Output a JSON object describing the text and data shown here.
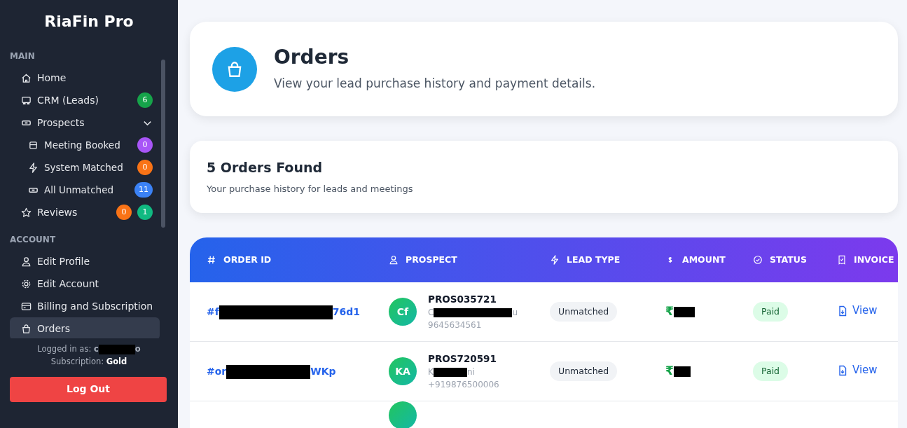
{
  "brand": "RiaFin Pro",
  "nav_sections": [
    {
      "title": "MAIN",
      "items": [
        {
          "label": "Home",
          "selected": false
        },
        {
          "label": "CRM (Leads)",
          "selected": false,
          "badges": [
            {
              "text": "6",
              "color": "#16a34a"
            }
          ]
        },
        {
          "label": "Prospects",
          "selected": false,
          "expanded": true,
          "children": [
            {
              "label": "Meeting Booked",
              "selected": false,
              "badges": [
                {
                  "text": "0",
                  "color": "#a855f7"
                }
              ]
            },
            {
              "label": "System Matched",
              "selected": false,
              "badges": [
                {
                  "text": "0",
                  "color": "#f97316"
                }
              ]
            },
            {
              "label": "All Unmatched",
              "selected": false,
              "badges": [
                {
                  "text": "11",
                  "color": "#3b82f6"
                }
              ]
            }
          ]
        },
        {
          "label": "Reviews",
          "selected": false,
          "badges": [
            {
              "text": "0",
              "color": "#f97316"
            },
            {
              "text": "1",
              "color": "#10b981"
            }
          ]
        }
      ]
    },
    {
      "title": "ACCOUNT",
      "items": [
        {
          "label": "Edit Profile",
          "selected": false
        },
        {
          "label": "Edit Account",
          "selected": false
        },
        {
          "label": "Billing and Subscription",
          "selected": false
        },
        {
          "label": "Orders",
          "selected": true
        }
      ]
    }
  ],
  "login": {
    "label": "Logged in as:",
    "name_start": "c",
    "name_end": "o",
    "subscription_label": "Subscription:",
    "subscription": "Gold"
  },
  "logout": "Log Out",
  "page_header": {
    "title": "Orders",
    "subtitle": "View your lead purchase history and payment details."
  },
  "summary": {
    "title": "5 Orders Found",
    "subtitle": "Your purchase history for leads and meetings"
  },
  "table": {
    "columns": [
      {
        "label": "ORDER ID"
      },
      {
        "label": "PROSPECT"
      },
      {
        "label": "LEAD TYPE"
      },
      {
        "label": "AMOUNT"
      },
      {
        "label": "STATUS"
      },
      {
        "label": "INVOICE"
      }
    ],
    "rows": [
      {
        "order_start": "#f",
        "order_end": "76d1",
        "initials": "Cf",
        "prospect_id": "PROS035721",
        "name_start": "C",
        "name_end": "u",
        "phone": "9645634561",
        "lead_type": "Unmatched",
        "amount_start": "₹",
        "status": "Paid",
        "invoice": "View"
      },
      {
        "order_start": "#or",
        "order_end": "WKp",
        "initials": "KA",
        "prospect_id": "PROS720591",
        "name_start": "K",
        "name_end": "ni",
        "phone": "+919876500006",
        "lead_type": "Unmatched",
        "amount_start": "₹",
        "status": "Paid",
        "invoice": "View"
      }
    ]
  }
}
